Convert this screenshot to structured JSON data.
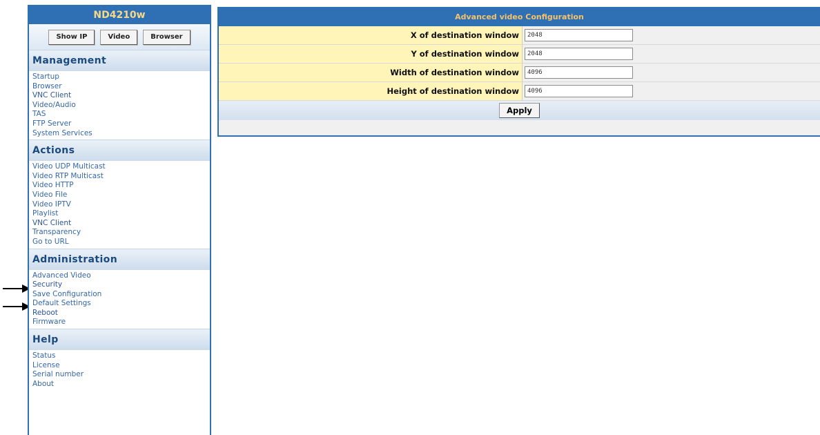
{
  "sidebar": {
    "device_name": "ND4210w",
    "buttons": [
      {
        "label": "Show IP"
      },
      {
        "label": "Video"
      },
      {
        "label": "Browser"
      }
    ],
    "sections": [
      {
        "title": "Management",
        "items": [
          "Startup",
          "Browser",
          "VNC Client",
          "Video/Audio",
          "TAS",
          "FTP Server",
          "System Services"
        ]
      },
      {
        "title": "Actions",
        "items": [
          "Video UDP Multicast",
          "Video RTP Multicast",
          "Video HTTP",
          "Video File",
          "Video IPTV",
          "Playlist",
          "VNC Client",
          "Transparency",
          "Go to URL"
        ]
      },
      {
        "title": "Administration",
        "items": [
          "Advanced Video",
          "Security",
          "Save Configuration",
          "Default Settings",
          "Reboot",
          "Firmware"
        ]
      },
      {
        "title": "Help",
        "items": [
          "Status",
          "License",
          "Serial number",
          "About"
        ]
      }
    ]
  },
  "main": {
    "title": "Advanced video Configuration",
    "fields": [
      {
        "label": "X of destination window",
        "value": "2048"
      },
      {
        "label": "Y of destination window",
        "value": "2048"
      },
      {
        "label": "Width of destination window",
        "value": "4096"
      },
      {
        "label": "Height of destination window",
        "value": "4096"
      }
    ],
    "apply_label": "Apply"
  },
  "icons": {
    "arrow_admin_heading": "right-arrow-icon",
    "arrow_advanced_video": "right-arrow-icon"
  }
}
